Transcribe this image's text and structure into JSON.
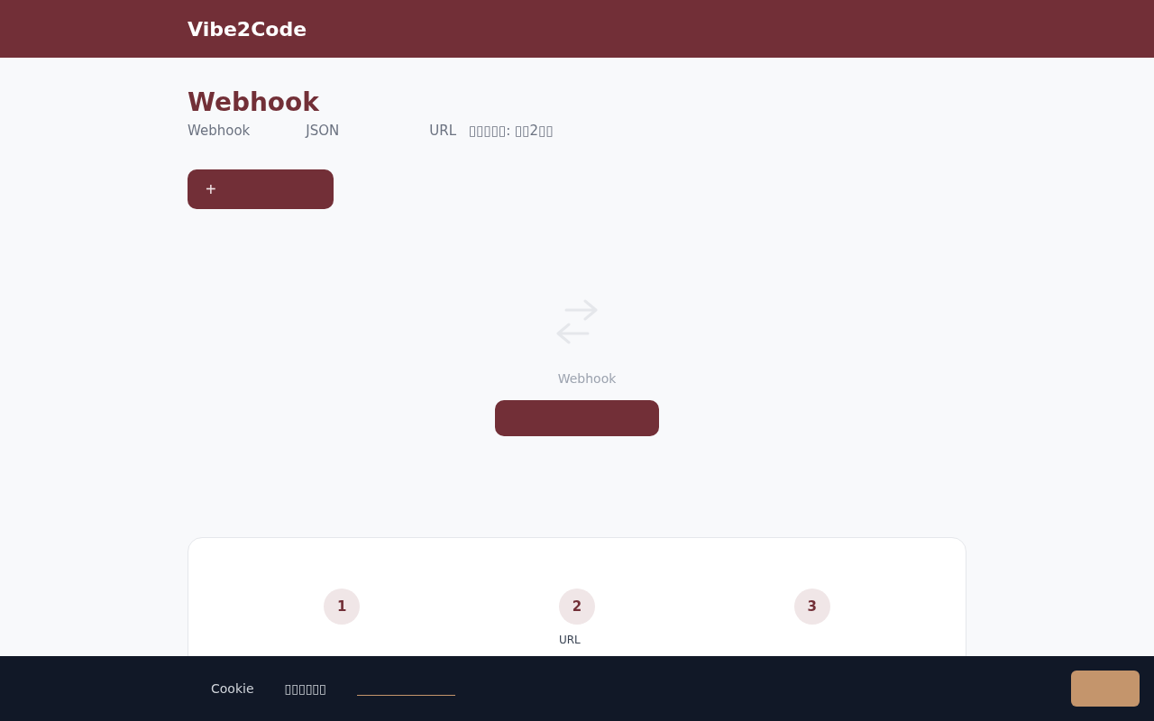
{
  "header": {
    "brand": "Vibe2Code"
  },
  "page": {
    "title": "Webhook",
    "subtitle": [
      "Webhook",
      "JSON",
      "URL",
      "▯▯▯▯▯: ▯▯2▯▯"
    ]
  },
  "add_button": {
    "icon": "+"
  },
  "empty_state": {
    "text": "Webhook"
  },
  "steps": [
    {
      "number": "1"
    },
    {
      "number": "2",
      "title": "URL"
    },
    {
      "number": "3"
    }
  ],
  "cookie_banner": {
    "texts": [
      "Cookie",
      "▯▯▯▯▯▯"
    ]
  }
}
